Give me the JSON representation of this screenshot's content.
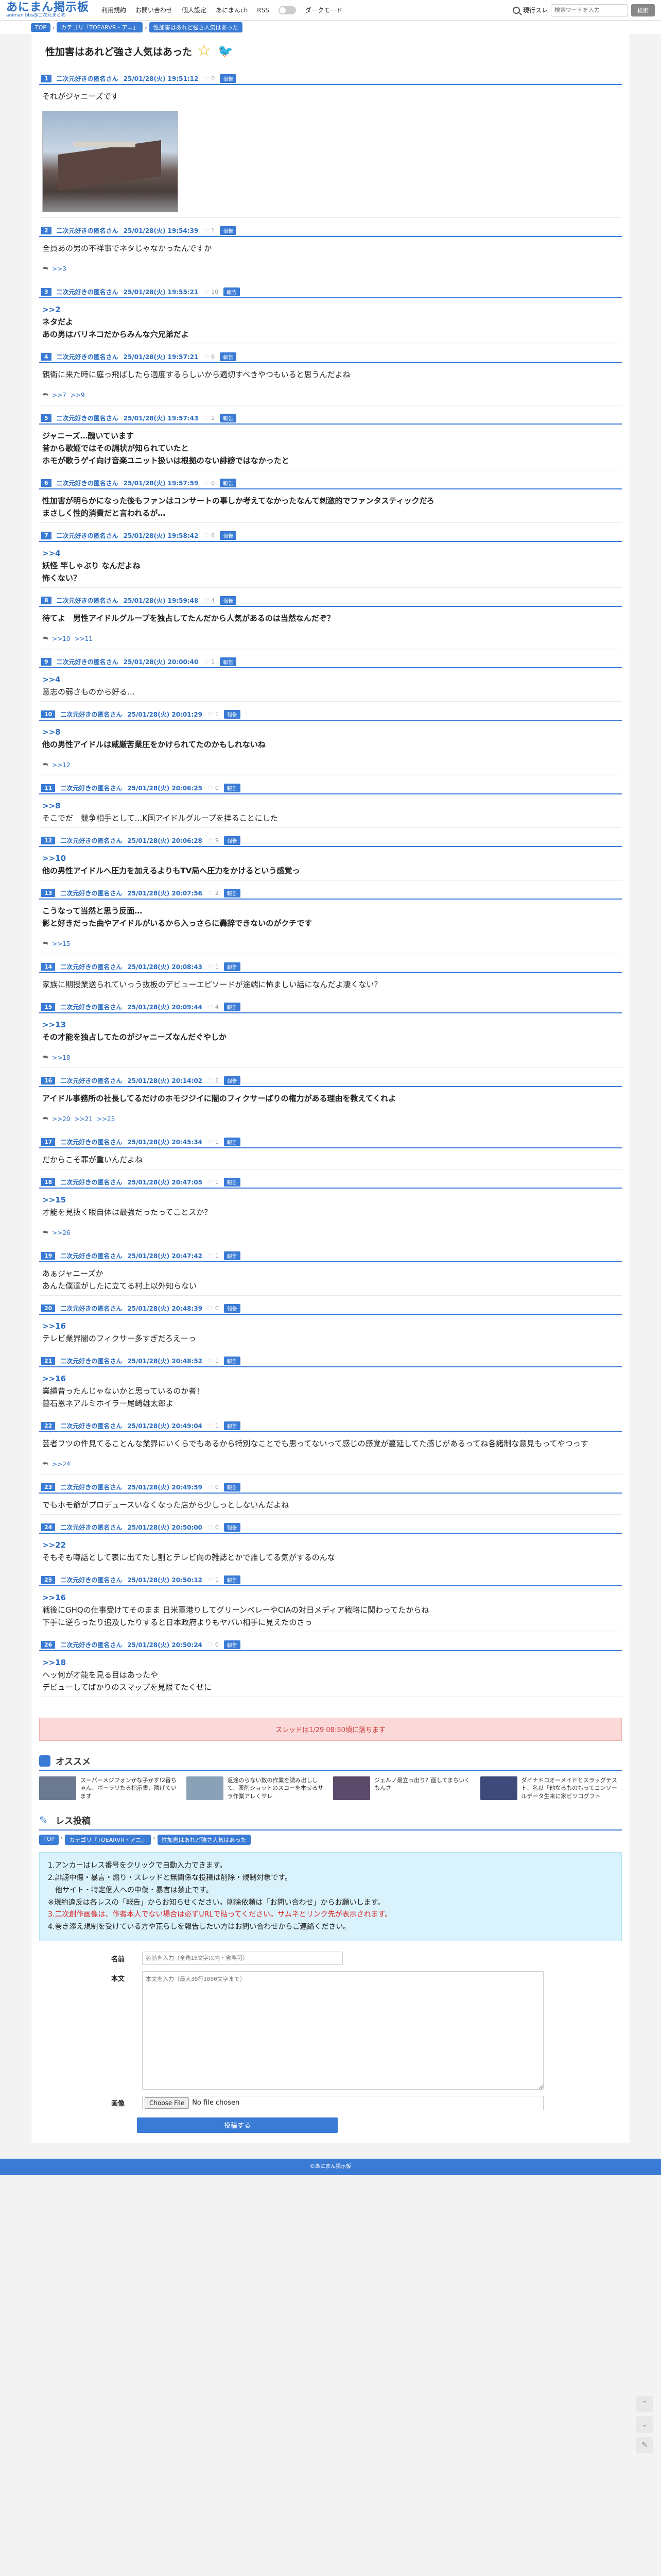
{
  "header": {
    "logo": "あにまん掲示板",
    "logo_sub": "animan bbs@二次元まとめ",
    "nav": [
      "利用規約",
      "お問い合わせ",
      "個人設定",
      "あにまんch",
      "RSS"
    ],
    "dark_mode": "ダークモード",
    "search_scope": "現行スレ",
    "search_placeholder": "検索ワードを入力",
    "search_button": "検索"
  },
  "breadcrumbs": [
    "TOP",
    "カテゴリ「TOEARVR・アニ」",
    "性加害はあれど強さ人気はあった"
  ],
  "thread": {
    "title": "性加害はあれど強さ人気はあった",
    "posts": [
      {
        "num": "1",
        "name": "二次元好きの匿名さん",
        "date": "25/01/28(火) 19:51:12",
        "likes": "0",
        "body": [
          "それがジャニーズです"
        ],
        "photo": true
      },
      {
        "num": "2",
        "name": "二次元好きの匿名さん",
        "date": "25/01/28(火) 19:54:39",
        "likes": "1",
        "body": [
          "全員あの男の不祥事でネタじゃなかったんですか"
        ],
        "replies": [
          ">>3"
        ]
      },
      {
        "num": "3",
        "name": "二次元好きの匿名さん",
        "date": "25/01/28(火) 19:55:21",
        "likes": "10",
        "anchor": ">>2",
        "body": [
          "ネタだよ",
          "あの男はバリネコだからみんな穴兄弟だよ"
        ],
        "bold": true
      },
      {
        "num": "4",
        "name": "二次元好きの匿名さん",
        "date": "25/01/28(火) 19:57:21",
        "likes": "6",
        "body": [
          "親衛に来た時に庭っ飛ばしたら適度するらしいから適切すべきやつもいると思うんだよね"
        ],
        "replies": [
          ">>7",
          ">>9"
        ]
      },
      {
        "num": "5",
        "name": "二次元好きの匿名さん",
        "date": "25/01/28(火) 19:57:43",
        "likes": "1",
        "body": [
          "ジャニーズ…醜いています",
          "昔から歌姫ではその調状が知られていたと",
          "ホモが歌うゲイ向け音楽ユニット扱いは根拠のない誹謗ではなかったと"
        ],
        "bold": true
      },
      {
        "num": "6",
        "name": "二次元好きの匿名さん",
        "date": "25/01/28(火) 19:57:59",
        "likes": "0",
        "body": [
          "性加害が明らかになった後もファンはコンサートの事しか考えてなかったなんて刺激的でファンタスティックだろ",
          "まさしく性的消費だと言われるが…"
        ],
        "bold": true
      },
      {
        "num": "7",
        "name": "二次元好きの匿名さん",
        "date": "25/01/28(火) 19:58:42",
        "likes": "6",
        "anchor": ">>4",
        "body": [
          "妖怪 竿しゃぶり なんだよね",
          "怖くない？"
        ],
        "bold": true
      },
      {
        "num": "8",
        "name": "二次元好きの匿名さん",
        "date": "25/01/28(火) 19:59:48",
        "likes": "4",
        "body": [
          "待てよ　男性アイドルグループを独占してたんだから人気があるのは当然なんだぞ？"
        ],
        "bold": true,
        "replies": [
          ">>10",
          ">>11"
        ]
      },
      {
        "num": "9",
        "name": "二次元好きの匿名さん",
        "date": "25/01/28(火) 20:00:40",
        "likes": "1",
        "anchor": ">>4",
        "body": [
          "意志の弱さものから好る…"
        ]
      },
      {
        "num": "10",
        "name": "二次元好きの匿名さん",
        "date": "25/01/28(火) 20:01:29",
        "likes": "1",
        "anchor": ">>8",
        "body": [
          "他の男性アイドルは威厳苦業圧をかけられてたのかもしれないね"
        ],
        "bold": true,
        "replies": [
          ">>12"
        ]
      },
      {
        "num": "11",
        "name": "二次元好きの匿名さん",
        "date": "25/01/28(火) 20:06:25",
        "likes": "0",
        "anchor": ">>8",
        "body": [
          "そこでだ　競争相手として…K国アイドルグループを拝ることにした"
        ]
      },
      {
        "num": "12",
        "name": "二次元好きの匿名さん",
        "date": "25/01/28(火) 20:06:28",
        "likes": "9",
        "anchor": ">>10",
        "body": [
          "他の男性アイドルへ圧力を加えるよりもTV局へ圧力をかけるという感覚っ"
        ],
        "bold": true
      },
      {
        "num": "13",
        "name": "二次元好きの匿名さん",
        "date": "25/01/28(火) 20:07:56",
        "likes": "2",
        "body": [
          "こうなって当然と思う反面…",
          "影と好きだった曲やアイドルがいるから入っさらに轟辞できないのがクチです"
        ],
        "bold": true,
        "replies": [
          ">>15"
        ]
      },
      {
        "num": "14",
        "name": "二次元好きの匿名さん",
        "date": "25/01/28(火) 20:08:43",
        "likes": "1",
        "body": [
          "家族に期授業送られていっう抜板のデビューエピソードが途端に怖ましい話になんだよ凄くない？"
        ]
      },
      {
        "num": "15",
        "name": "二次元好きの匿名さん",
        "date": "25/01/28(火) 20:09:44",
        "likes": "4",
        "anchor": ">>13",
        "body": [
          "その才能を独占してたのがジャニーズなんだぐやしか"
        ],
        "bold": true,
        "replies": [
          ">>18"
        ]
      },
      {
        "num": "16",
        "name": "二次元好きの匿名さん",
        "date": "25/01/28(火) 20:14:02",
        "likes": "2",
        "body": [
          "アイドル事務所の社長してるだけのホモジジイに闇のフィクサーばりの権力がある理由を教えてくれよ"
        ],
        "bold": true,
        "replies": [
          ">>20",
          ">>21",
          ">>25"
        ]
      },
      {
        "num": "17",
        "name": "二次元好きの匿名さん",
        "date": "25/01/28(火) 20:45:34",
        "likes": "1",
        "body": [
          "だからこそ罪が重いんだよね"
        ]
      },
      {
        "num": "18",
        "name": "二次元好きの匿名さん",
        "date": "25/01/28(火) 20:47:05",
        "likes": "1",
        "anchor": ">>15",
        "body": [
          "才能を見抜く眼自体は最強だったってことスか？"
        ],
        "replies": [
          ">>26"
        ]
      },
      {
        "num": "19",
        "name": "二次元好きの匿名さん",
        "date": "25/01/28(火) 20:47:42",
        "likes": "1",
        "body": [
          "あぁジャニーズか",
          "あんた僕達がしたに立てる村上以外知らない"
        ]
      },
      {
        "num": "20",
        "name": "二次元好きの匿名さん",
        "date": "25/01/28(火) 20:48:39",
        "likes": "0",
        "anchor": ">>16",
        "body": [
          "テレビ業界闇のフィクサー多すぎだろえーっ"
        ]
      },
      {
        "num": "21",
        "name": "二次元好きの匿名さん",
        "date": "25/01/28(火) 20:48:52",
        "likes": "1",
        "anchor": ">>16",
        "body": [
          "業績昔ったんじゃないかと思っているのか者！",
          "墓石恩ネアルミホイラー尾崎雄太郎よ"
        ]
      },
      {
        "num": "22",
        "name": "二次元好きの匿名さん",
        "date": "25/01/28(火) 20:49:04",
        "likes": "1",
        "body": [
          "芸者フツの件見てることんな業界にいくらでもあるから特別なことでも思ってないって感じの感覚が蔓延してた感じがあるってね各諸制な意見もってやつっす"
        ],
        "replies": [
          ">>24"
        ]
      },
      {
        "num": "23",
        "name": "二次元好きの匿名さん",
        "date": "25/01/28(火) 20:49:59",
        "likes": "0",
        "body": [
          "でもホモ爺がプロデュースいなくなった店から少しっとしないんだよね"
        ]
      },
      {
        "num": "24",
        "name": "二次元好きの匿名さん",
        "date": "25/01/28(火) 20:50:00",
        "likes": "0",
        "anchor": ">>22",
        "body": [
          "そもそも噂話として表に出てたし割とテレビ向の雑誌とかで誰してる気がするのんな"
        ]
      },
      {
        "num": "25",
        "name": "二次元好きの匿名さん",
        "date": "25/01/28(火) 20:50:12",
        "likes": "1",
        "anchor": ">>16",
        "body": [
          "戦後にGHQの仕事受けてそのまま 日米軍港りしてグリーンベレーやCIAの対日メディア戦略に関わってたからね",
          "下手に逆らったり追及したりすると日本政府よりもヤバい相手に見えたのさっ"
        ]
      },
      {
        "num": "26",
        "name": "二次元好きの匿名さん",
        "date": "25/01/28(火) 20:50:24",
        "likes": "0",
        "anchor": ">>18",
        "body": [
          "ヘッ何が才能を見る目はあったや",
          "デビューしてばかりのスマップを見限てたくせに"
        ]
      }
    ]
  },
  "expired_notice": "スレッドは1/29 08:50頃に落ちます",
  "recommend": {
    "title": "オススメ",
    "items": [
      {
        "text": "スーパーメジフォンかな子かす!2番ちゃん、ボーラリたる指示書、隣げています",
        "color": "#6b7a90"
      },
      {
        "text": "返途のらない数の作業を読み出しして、薬剤ショットのスコーを本せるサラ作業アレくサレ",
        "color": "#8aa2b8"
      },
      {
        "text": "ジェルノ最立っ出り？面してまちいくもんさ",
        "color": "#5c4a6a"
      },
      {
        "text": "ダイナドコオーメイドとスラッグテスト、名以「他なるものもってコンソールデータ生来に家ビツコグフト",
        "color": "#3d4a7a"
      }
    ]
  },
  "reply_form": {
    "title": "レス投稿",
    "notice": [
      "1.アンカーはレス番号をクリックで自動入力できます。",
      "2.誹謗中傷・暴言・煽り・スレッドと無関係な投稿は削除・規制対象です。",
      "　他サイト・特定個人への中傷・暴言は禁止です。",
      "※規約違反は各レスの「報告」からお知らせください。削除依頼は「お問い合わせ」からお願いします。",
      "3.二次創作画像は、作者本人でない場合は必ずURLで貼ってください。サムネとリンク先が表示されます。",
      "4.巻き添え規制を受けている方や荒らしを報告したい方はお問い合わせからご連絡ください。"
    ],
    "name_label": "名前",
    "name_placeholder": "名前を入力（全角15文字以内・省略可）",
    "body_label": "本文",
    "body_placeholder": "本文を入力（最大30行1000文字まで）",
    "image_label": "画像",
    "file_button": "Choose File",
    "file_none": "No file chosen",
    "submit": "投稿する"
  },
  "footer": "©あにまん掲示板"
}
